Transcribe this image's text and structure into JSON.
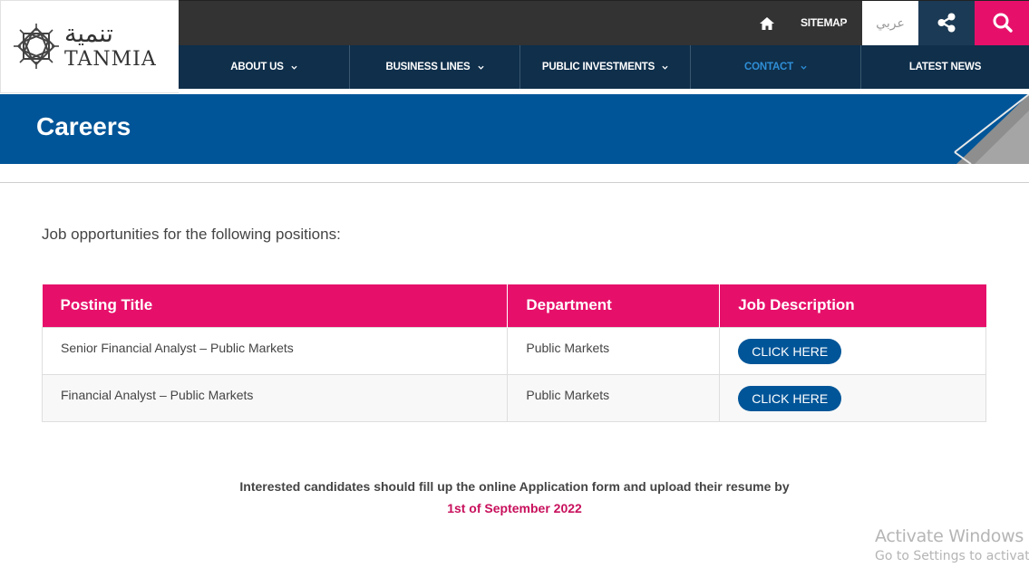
{
  "logo": {
    "arabic": "تنمية",
    "english": "TANMIA"
  },
  "topbar": {
    "sitemap": "SITEMAP",
    "language": "عربي"
  },
  "nav": [
    {
      "label": "ABOUT US",
      "dropdown": true,
      "active": false
    },
    {
      "label": "BUSINESS LINES",
      "dropdown": true,
      "active": false
    },
    {
      "label": "PUBLIC INVESTMENTS",
      "dropdown": true,
      "active": false
    },
    {
      "label": "CONTACT",
      "dropdown": true,
      "active": true
    },
    {
      "label": "LATEST NEWS",
      "dropdown": false,
      "active": false
    }
  ],
  "banner": {
    "title": "Careers"
  },
  "intro": "Job opportunities for the following positions:",
  "table": {
    "headers": [
      "Posting Title",
      "Department",
      "Job Description"
    ],
    "rows": [
      {
        "title": "Senior Financial Analyst – Public Markets",
        "department": "Public Markets",
        "button": "CLICK HERE"
      },
      {
        "title": "Financial Analyst – Public Markets",
        "department": "Public Markets",
        "button": "CLICK HERE"
      }
    ]
  },
  "footer": {
    "note": "Interested candidates should fill up the online Application form and upload their resume by",
    "date": "1st of September 2022"
  },
  "watermark": {
    "line1": "Activate Windows",
    "line2": "Go to Settings to activate"
  },
  "colors": {
    "navy": "#0f2f4b",
    "blue": "#005598",
    "pink": "#e6106a",
    "dark": "#333333",
    "active_link": "#2f8fd8"
  }
}
